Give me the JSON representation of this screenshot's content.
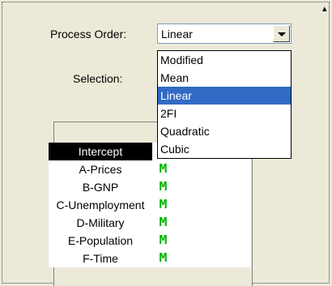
{
  "form": {
    "process_order_label": "Process Order:",
    "selection_label": "Selection:",
    "combo_value": "Linear"
  },
  "dropdown": {
    "options": [
      "Modified",
      "Mean",
      "Linear",
      "2FI",
      "Quadratic",
      "Cubic"
    ],
    "selected": "Linear"
  },
  "table": {
    "header": "Intercept",
    "rows": [
      {
        "name": "A-Prices",
        "mark": "M"
      },
      {
        "name": "B-GNP",
        "mark": "M"
      },
      {
        "name": "C-Unemployment",
        "mark": "M"
      },
      {
        "name": "D-Military",
        "mark": "M"
      },
      {
        "name": "E-Population",
        "mark": "M"
      },
      {
        "name": "F-Time",
        "mark": "M"
      }
    ]
  },
  "colors": {
    "highlight": "#316ac5",
    "model_mark": "#00b400"
  }
}
